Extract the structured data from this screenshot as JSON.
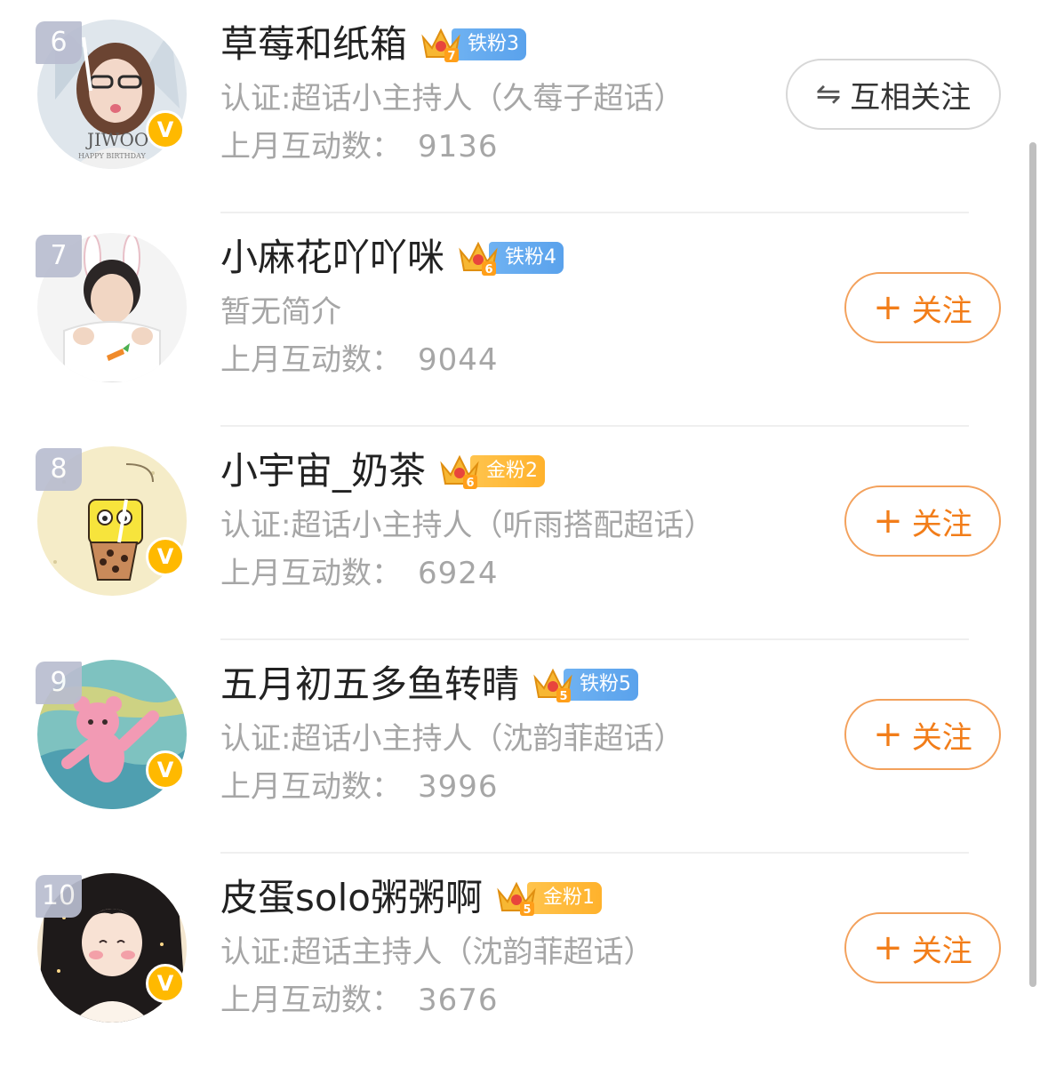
{
  "colors": {
    "accent": "#f27d19",
    "iron_fan": "#5aa2ec",
    "gold_fan": "#ffb22c",
    "verified": "#ffb900"
  },
  "users": [
    {
      "rank": "6",
      "name": "草莓和纸箱",
      "fan_level": "铁粉3",
      "fan_type": "iron",
      "crown_num": "7",
      "desc": "认证:超话小主持人（久莓子超话）",
      "stat_label": "上月互动数：",
      "stat_value": "9136",
      "verified": true,
      "avatar_text": "JIWOO",
      "avatar_subtext": "HAPPY BIRTHDAY",
      "button": {
        "type": "mutual",
        "icon": "⇋",
        "label": "互相关注"
      }
    },
    {
      "rank": "7",
      "name": "小麻花吖吖咪",
      "fan_level": "铁粉4",
      "fan_type": "iron",
      "crown_num": "6",
      "desc": "暂无简介",
      "stat_label": "上月互动数：",
      "stat_value": "9044",
      "verified": false,
      "button": {
        "type": "plus",
        "icon": "+",
        "label": "关注"
      }
    },
    {
      "rank": "8",
      "name": "小宇宙_奶茶",
      "fan_level": "金粉2",
      "fan_type": "gold",
      "crown_num": "6",
      "desc": "认证:超话小主持人（听雨搭配超话）",
      "stat_label": "上月互动数：",
      "stat_value": "6924",
      "verified": true,
      "button": {
        "type": "plus",
        "icon": "+",
        "label": "关注"
      }
    },
    {
      "rank": "9",
      "name": "五月初五多鱼转晴",
      "fan_level": "铁粉5",
      "fan_type": "iron",
      "crown_num": "5",
      "desc": "认证:超话小主持人（沈韵菲超话）",
      "stat_label": "上月互动数：",
      "stat_value": "3996",
      "verified": true,
      "button": {
        "type": "plus",
        "icon": "+",
        "label": "关注"
      }
    },
    {
      "rank": "10",
      "name": "皮蛋solo粥粥啊",
      "fan_level": "金粉1",
      "fan_type": "gold",
      "crown_num": "5",
      "desc": "认证:超话主持人（沈韵菲超话）",
      "stat_label": "上月互动数：",
      "stat_value": "3676",
      "verified": true,
      "button": {
        "type": "plus",
        "icon": "+",
        "label": "关注"
      }
    }
  ]
}
